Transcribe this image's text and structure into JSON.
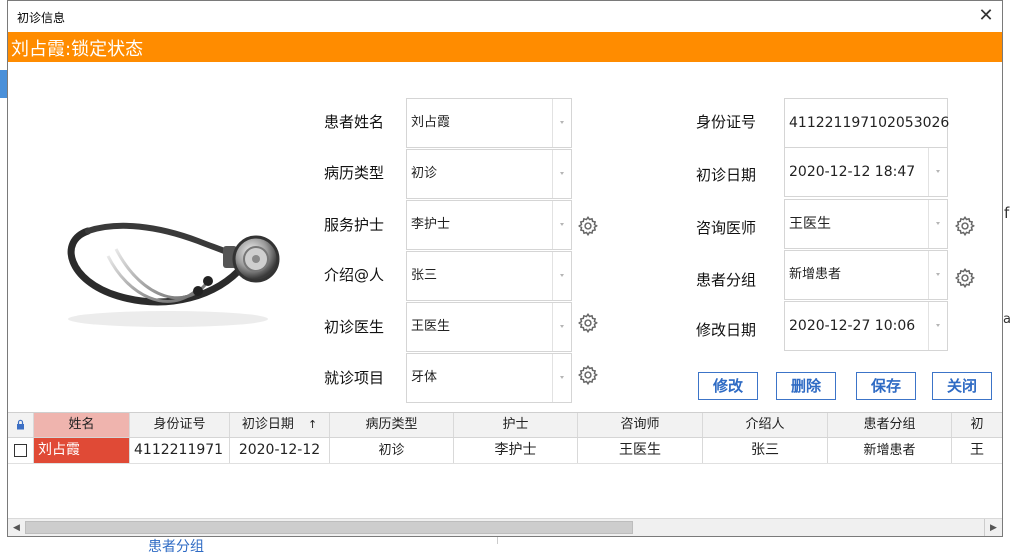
{
  "window": {
    "title": "初诊信息",
    "close_glyph": "✕"
  },
  "banner": {
    "text": "刘占霞:锁定状态",
    "color": "#ff8c00"
  },
  "photo": {
    "icon": "stethoscope-image"
  },
  "form": {
    "left": [
      {
        "label": "患者姓名",
        "value": "刘占霞",
        "gear": false
      },
      {
        "label": "病历类型",
        "value": "初诊",
        "gear": false
      },
      {
        "label": "服务护士",
        "value": "李护士",
        "gear": true
      },
      {
        "label": "介绍@人",
        "value": "张三",
        "gear": false
      },
      {
        "label": "初诊医生",
        "value": "王医生",
        "gear": true
      },
      {
        "label": "就诊项目",
        "value": "牙体",
        "gear": true
      }
    ],
    "right": [
      {
        "label": "身份证号",
        "value": "411221197102053026",
        "gear": false
      },
      {
        "label": "初诊日期",
        "value": "2020-12-12 18:47",
        "gear": false
      },
      {
        "label": "咨询医师",
        "value": "王医生",
        "gear": true
      },
      {
        "label": "患者分组",
        "value": "新增患者",
        "gear": true
      },
      {
        "label": "修改日期",
        "value": "2020-12-27 10:06",
        "gear": false
      }
    ]
  },
  "buttons": {
    "edit": "修改",
    "delete": "删除",
    "save": "保存",
    "close": "关闭"
  },
  "table": {
    "lock_icon": "lock-icon",
    "sort_glyph": "↑",
    "columns": [
      "姓名",
      "身份证号",
      "初诊日期",
      "病历类型",
      "护士",
      "咨询师",
      "介绍人",
      "患者分组",
      "初"
    ],
    "rows": [
      {
        "cells": [
          "刘占霞",
          "4112211971",
          "2020-12-12",
          "初诊",
          "李护士",
          "王医生",
          "张三",
          "新增患者",
          "王"
        ]
      }
    ]
  },
  "scrollbar": {
    "left": "◀",
    "right": "▶"
  },
  "background_fragments": {
    "text1": "f",
    "text2": "a",
    "text3": "患者分组"
  },
  "colors": {
    "selected_name_bg": "#e04a36",
    "header_name_bg": "#efb4ae",
    "button_border": "#3c74c8"
  }
}
